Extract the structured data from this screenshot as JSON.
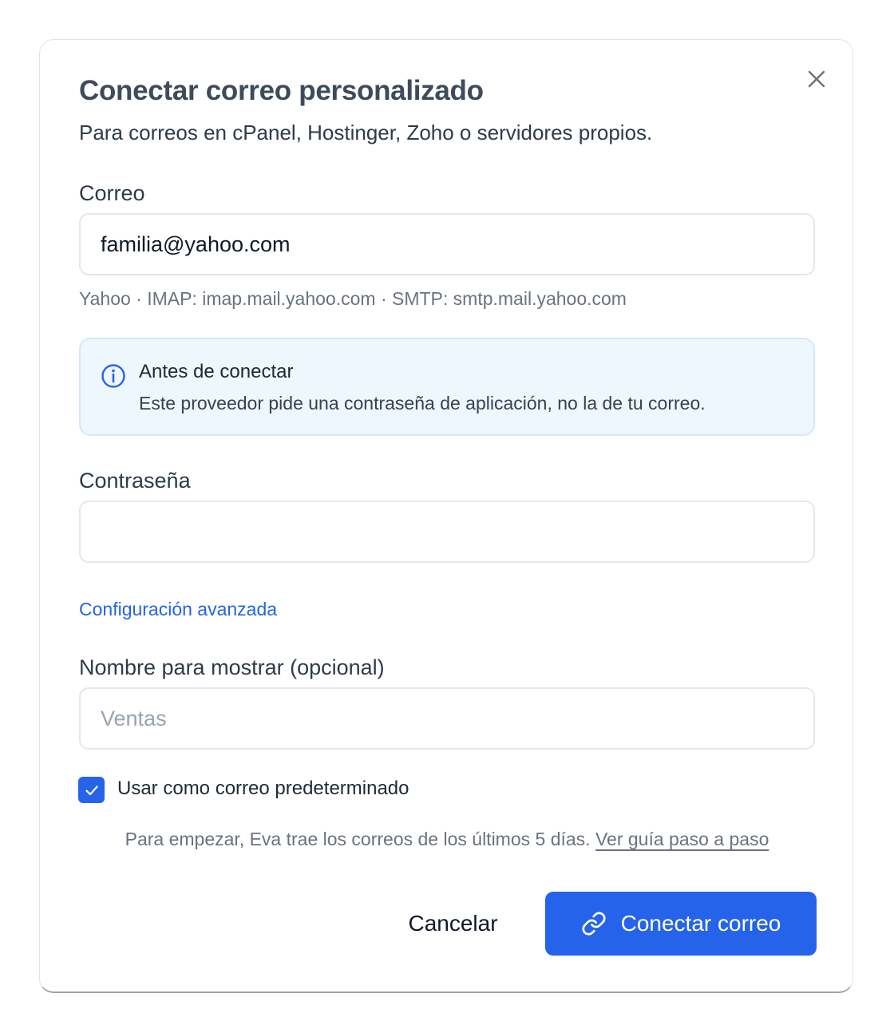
{
  "dialog": {
    "title": "Conectar correo personalizado",
    "subtitle": "Para correos en cPanel, Hostinger, Zoho o servidores propios.",
    "close_icon": "close-icon"
  },
  "email": {
    "label": "Correo",
    "value": "familia@yahoo.com",
    "hint": "Yahoo · IMAP: imap.mail.yahoo.com · SMTP: smtp.mail.yahoo.com"
  },
  "notice": {
    "icon": "info-icon",
    "title": "Antes de conectar",
    "text": "Este proveedor pide una contraseña de aplicación, no la de tu correo."
  },
  "password": {
    "label": "Contraseña",
    "value": ""
  },
  "advanced_link": "Configuración avanzada",
  "display_name": {
    "label": "Nombre para mostrar (opcional)",
    "placeholder": "Ventas",
    "value": ""
  },
  "default_checkbox": {
    "label": "Usar como correo predeterminado",
    "checked": true
  },
  "footnote": {
    "text": "Para empezar, Eva trae los correos de los últimos 5 días.",
    "link": "Ver guía paso a paso"
  },
  "actions": {
    "cancel": "Cancelar",
    "connect": "Conectar correo",
    "connect_icon": "link-icon"
  },
  "colors": {
    "accent": "#2563eb",
    "notice_bg": "#eef6fe",
    "notice_border": "#d7e8fb"
  }
}
